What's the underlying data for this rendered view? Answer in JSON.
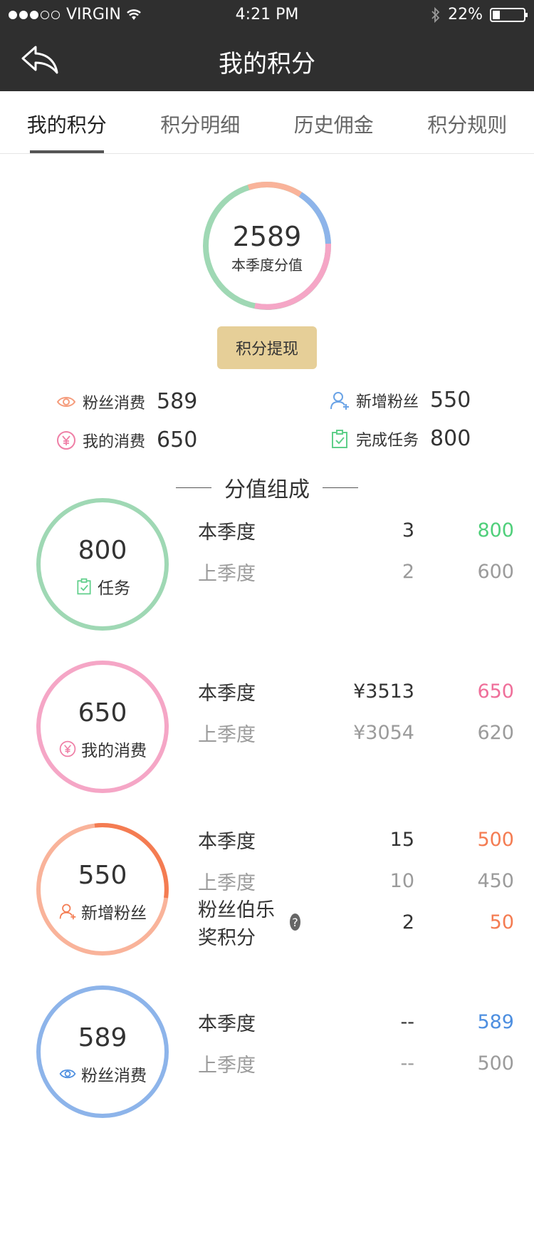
{
  "status_bar": {
    "carrier": "VIRGIN",
    "time": "4:21 PM",
    "battery": "22%"
  },
  "nav": {
    "title": "我的积分"
  },
  "tabs": [
    {
      "label": "我的积分"
    },
    {
      "label": "积分明细"
    },
    {
      "label": "历史佣金"
    },
    {
      "label": "积分规则"
    }
  ],
  "summary": {
    "total": "2589",
    "total_label": "本季度分值",
    "withdraw_label": "积分提现",
    "stats": [
      {
        "label": "粉丝消费",
        "value": "589",
        "icon": "eye-icon"
      },
      {
        "label": "新增粉丝",
        "value": "550",
        "icon": "user-plus-icon"
      },
      {
        "label": "我的消费",
        "value": "650",
        "icon": "yen-icon"
      },
      {
        "label": "完成任务",
        "value": "800",
        "icon": "clipboard-check-icon"
      }
    ]
  },
  "section_title": "分值组成",
  "components": [
    {
      "value": "800",
      "label": "任务",
      "icon": "clipboard-check-icon",
      "color": "#9fd8b4",
      "accent": "#4fcf7a",
      "rows": [
        {
          "period": "本季度",
          "count": "3",
          "points": "800"
        },
        {
          "period": "上季度",
          "count": "2",
          "points": "600"
        }
      ]
    },
    {
      "value": "650",
      "label": "我的消费",
      "icon": "yen-icon",
      "color": "#f5a6c6",
      "accent": "#ef6f9a",
      "rows": [
        {
          "period": "本季度",
          "count": "¥3513",
          "points": "650"
        },
        {
          "period": "上季度",
          "count": "¥3054",
          "points": "620"
        }
      ]
    },
    {
      "value": "550",
      "label": "新增粉丝",
      "icon": "user-plus-icon",
      "color": "#f9b39a",
      "accent": "#f47c52",
      "rows": [
        {
          "period": "本季度",
          "count": "15",
          "points": "500"
        },
        {
          "period": "上季度",
          "count": "10",
          "points": "450"
        },
        {
          "period": "粉丝伯乐奖积分",
          "count": "2",
          "points": "50"
        }
      ]
    },
    {
      "value": "589",
      "label": "粉丝消费",
      "icon": "eye-icon",
      "color": "#8db4ea",
      "accent": "#4e8fe0",
      "rows": [
        {
          "period": "本季度",
          "count": "--",
          "points": "589"
        },
        {
          "period": "上季度",
          "count": "--",
          "points": "500"
        }
      ]
    }
  ]
}
